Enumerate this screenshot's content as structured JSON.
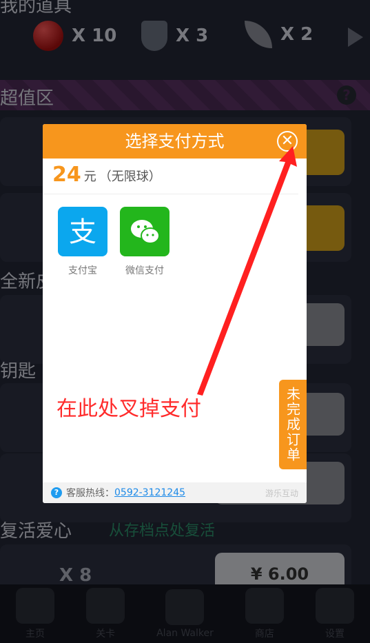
{
  "app": {
    "section_items_title": "我的道具",
    "items": [
      {
        "icon": "red-ball-icon",
        "count": "X 10"
      },
      {
        "icon": "shield-icon",
        "count": "X 3"
      },
      {
        "icon": "wing-icon",
        "count": "X 2"
      }
    ],
    "value_zone": "超值区",
    "new_section": "全新皮",
    "keys_section": "钥匙",
    "revive_title": "复活爱心",
    "revive_sub": "从存档点处复活",
    "revive_count": "X 8",
    "revive_price": "¥ 6.00",
    "nav": [
      {
        "label": "主页"
      },
      {
        "label": "关卡"
      },
      {
        "label": "Alan Walker"
      },
      {
        "label": "商店"
      },
      {
        "label": "设置"
      }
    ]
  },
  "modal": {
    "title": "选择支付方式",
    "close_icon": "close-circle-icon",
    "price_amount": "24",
    "price_unit": "元",
    "price_desc": "（无限球）",
    "methods": [
      {
        "label": "支付宝",
        "icon": "alipay-icon",
        "color": "#0BA7EE"
      },
      {
        "label": "微信支付",
        "icon": "wechat-icon",
        "color": "#23B61C"
      }
    ],
    "annotation": "在此处叉掉支付",
    "footer_label": "客服热线：",
    "footer_phone": "0592-3121245",
    "footer_brand": "游乐互动",
    "side_tab": "未完成订单"
  },
  "colors": {
    "accent": "#F7961D",
    "annotation": "#FF2B2B"
  }
}
